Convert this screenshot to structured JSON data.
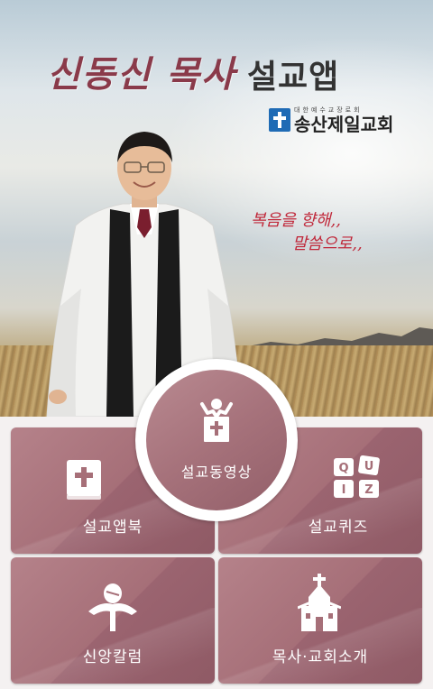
{
  "hero": {
    "title_name": "신동신 목사",
    "title_app": "설교앱",
    "church_subtitle": "대한예수교장로회",
    "church_name": "송산제일교회",
    "slogan_line1": "복음을 향해,,",
    "slogan_line2": "말씀으로,,"
  },
  "menu": {
    "center_label": "설교동영상",
    "book_label": "설교앱북",
    "quiz_label": "설교퀴즈",
    "column_label": "신앙칼럼",
    "intro_label": "목사·교회소개",
    "quiz_letters": [
      "Q",
      "U",
      "I",
      "Z"
    ]
  },
  "colors": {
    "tile": "#a66f78",
    "title_name": "#8a3a4a",
    "slogan": "#c0283a",
    "church_blue": "#1f6bb5"
  }
}
